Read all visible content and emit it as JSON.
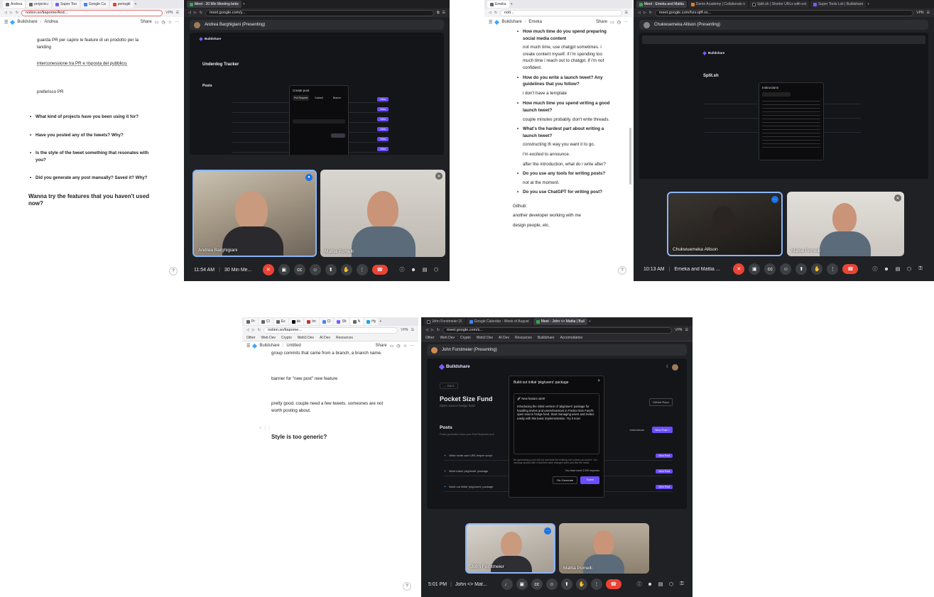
{
  "tl": {
    "tabs": [
      "Andrea",
      "projects.i",
      "Super Too",
      "Google Ca",
      "portogiti"
    ],
    "url": "notion.so/tiapome/And...",
    "breadcrumb": [
      "Buildshare",
      "Andrea"
    ],
    "share": "Share",
    "paras": [
      "guarda PR per capire le feature di un prodotto per la landing",
      "interconessione tra PR e risposta del pubblico.",
      "preferisco PR"
    ],
    "bullets": [
      "What kind of projects have you been using it for?",
      "Have you posted any of the tweets? Why?",
      "Is the style of the tweet something that resonates with you?",
      "Did you generate any post manually? Saved it? Why?"
    ],
    "heading": "Wanna try the features that you haven't used now?",
    "help": "?"
  },
  "tm": {
    "tab": "Meet - 30 Min Meeting betw",
    "url": "meet.google.com/y...",
    "presenter": "Andrea Barghigiani (Presenting)",
    "app": "Buildshare",
    "page_title": "Underdog Tracker",
    "posts_label": "Posts",
    "modal_title": "Create post",
    "modal_tabs": [
      "Pull Request",
      "Commit",
      "Branch"
    ],
    "tile1": "Andrea Barghigiani",
    "tile2": "Mattia Pomelli",
    "time": "11:54 AM",
    "meeting": "30 Min Me..."
  },
  "tr": {
    "tab": "Emeka",
    "url": "noti...",
    "breadcrumb": [
      "Buildshare",
      "Emeka"
    ],
    "share": "Share",
    "items": [
      {
        "q": "How much time do you spend preparing social media content",
        "a": [
          "not much time, use chatgpt sometimes. i create content myself. if i'm spending too much time i reach out to chatgpt. if i'm not confident."
        ]
      },
      {
        "q": "How do you write a launch tweet? Any guidelines that you follow?",
        "a": [
          "i don't have a template"
        ]
      },
      {
        "q": "How much time you spend writing a good launch tweet?",
        "a": [
          "couple minutes probably. don't write threads."
        ]
      },
      {
        "q": "What's the hardest part about writing a launch tweet?",
        "a": [
          "constructing th way you want it to go.",
          "i'm excited to announce.",
          "after the introduction, what do i write after?"
        ]
      },
      {
        "q": "Do you use any tools for writing posts?",
        "a": [
          "not at the moment."
        ]
      },
      {
        "q": "Do you use ChatGPT for writing post?",
        "a": []
      }
    ],
    "tail": [
      "Github:",
      "another developer working with me",
      "design people, etc."
    ],
    "help": "?"
  },
  "trm": {
    "tabs": [
      "Meet - Emeka and Mattia",
      "Dome Academy | Collaborate n",
      "Split.sh | Shorter URLs with ext",
      "Super Tools List | Buildshare"
    ],
    "url": "meet.google.com/hzx-qiff-xv...",
    "presenter": "Chukwuemeka Allison (Presenting)",
    "app": "Buildshare",
    "page_title": "Split.sh",
    "modal_title": "Instructions",
    "tile1": "Chukwuemeka Allison",
    "tile2": "Mattia Pomelli",
    "time": "10:13 AM",
    "meeting": "Emeka and Mattia ..."
  },
  "bl": {
    "tabs": [
      "Pr",
      "Cl",
      "Ex",
      "de",
      "Im",
      "Cl",
      "Sh",
      "N",
      "Hy"
    ],
    "url": "notion.so/tiapome...",
    "bookmarks": [
      "Other",
      "Web Dev",
      "Crypto",
      "Web3 Dev",
      "AI Dev",
      "Resources"
    ],
    "breadcrumb": [
      "Buildshare",
      "Untitled"
    ],
    "share": "Share",
    "paras": [
      "group commits that came from a branch, a branch name.",
      "banner for \"new post\" new feature",
      "pretty good. couple need a few tweets. someones are not worth posting about."
    ],
    "heading": "Style is too generic?",
    "help": "?"
  },
  "brm": {
    "tabs": [
      "John Forstmeier (X",
      "Google Calendar - Week of August",
      "Meet - John <> Mattia | Buil"
    ],
    "url": "meet.google.com/s...",
    "bookmarks": [
      "Other",
      "Web Dev",
      "Crypto",
      "Web3 Dev",
      "AI Dev",
      "Resources",
      "Buildshare",
      "Accomodation"
    ],
    "presenter": "John Forstmeier (Presenting)",
    "app": "Buildshare",
    "back": "← Back",
    "page_title": "Pocket Size Fund",
    "page_sub": "Open source hedge fund",
    "github_btn": "GitHub Repo",
    "posts_label": "Posts",
    "posts_sub": "Posts generated from your Pull Requests and",
    "instructions": "Instructions",
    "new_post": "New Post +",
    "rows": [
      "Write invite user URL helper script",
      "Build initial 'pkg/invite' package",
      "Build out initial 'pkg/users' package"
    ],
    "view_post": "View Post",
    "modal_title": "Build out initial 'pkg/users' package",
    "modal_text": "🚀 New feature alert!\n\nIntroducing the initial version of 'pkg/users' package for handling invites and users/investors in Pocket Size Fund's open source hedge fund. Start managing users and invites easily with this basic implementation. Try it now!",
    "modal_note": "Re-generating a post will not overwrite the existing one unless you save it. You can play around with it and then save changes when you like the result.",
    "usage": "You have used 2/100 requests",
    "regenerate": "Re-Generate",
    "tweet": "Tweet",
    "tile1": "John Forstmeier",
    "tile2": "Mattia Pomelli",
    "time": "5:01 PM",
    "meeting": "John <> Mat..."
  }
}
